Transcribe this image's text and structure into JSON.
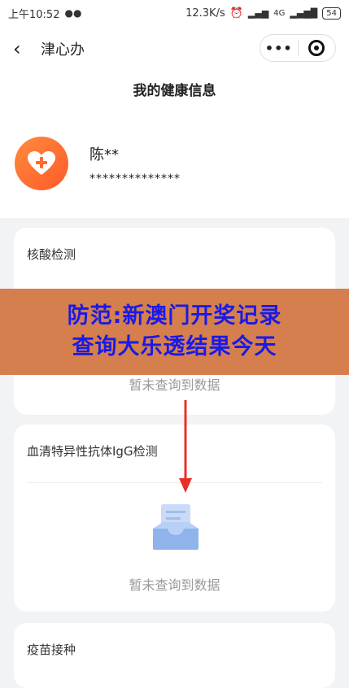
{
  "status_bar": {
    "time": "上午10:52",
    "network_speed": "12.3K/s",
    "signal_label": "4G",
    "battery": "54"
  },
  "nav": {
    "back_icon": "‹",
    "app_title": "津心办",
    "more_icon": "•••"
  },
  "page": {
    "title": "我的健康信息"
  },
  "profile": {
    "name": "陈**",
    "id_masked": "**************"
  },
  "cards": [
    {
      "title": "核酸检测",
      "empty_text": "暂未查询到数据"
    },
    {
      "title": "血清特异性抗体IgG检测",
      "empty_text": "暂未查询到数据"
    },
    {
      "title": "疫苗接种"
    }
  ],
  "banner": {
    "line1": "防范:新澳门开奖记录",
    "line2": "查询大乐透结果今天"
  },
  "colors": {
    "accent": "#ff6a2e",
    "banner_bg": "#d67f4e",
    "banner_text": "#1a1ae6",
    "arrow": "#e8302a"
  }
}
